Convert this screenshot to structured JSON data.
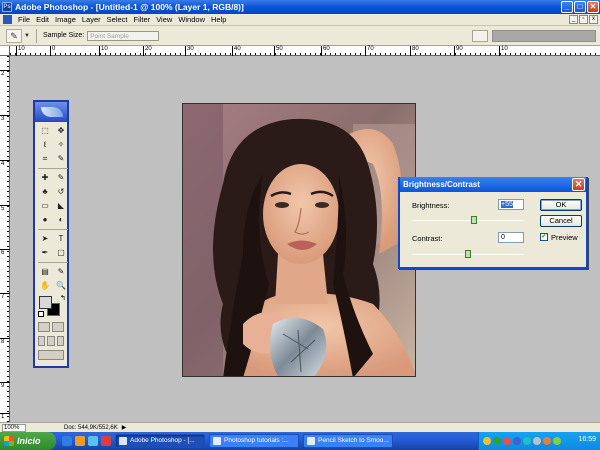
{
  "window": {
    "title": "Adobe Photoshop - [Untitled-1 @ 100% (Layer 1, RGB/8)]",
    "controls": {
      "minimize": "_",
      "maximize": "□",
      "close": "✕"
    }
  },
  "menu": [
    "File",
    "Edit",
    "Image",
    "Layer",
    "Select",
    "Filter",
    "View",
    "Window",
    "Help"
  ],
  "doc_controls": {
    "minimize": "_",
    "restore": "▫",
    "close": "x"
  },
  "options": {
    "tool_icon": "eyedropper-icon",
    "sample_size_label": "Sample Size:",
    "sample_size_value": "Point Sample"
  },
  "rulers": {
    "horizontal": [
      "10",
      "0",
      "10",
      "20",
      "30",
      "40",
      "50",
      "60",
      "70",
      "80",
      "90",
      "10"
    ],
    "vertical": [
      "2",
      "3",
      "4",
      "5",
      "6",
      "7",
      "8",
      "9",
      "1"
    ]
  },
  "toolbox": {
    "tools": [
      "marquee-icon",
      "move-icon",
      "lasso-icon",
      "magic-wand-icon",
      "crop-icon",
      "slice-icon",
      "healing-brush-icon",
      "brush-icon",
      "clone-stamp-icon",
      "history-brush-icon",
      "eraser-icon",
      "paint-bucket-icon",
      "blur-icon",
      "dodge-icon",
      "path-selection-icon",
      "type-icon",
      "pen-icon",
      "shape-icon",
      "notes-icon",
      "eyedropper-icon",
      "hand-icon",
      "zoom-icon"
    ],
    "glyphs": [
      "⬚",
      "✥",
      "ℓ",
      "✧",
      "⌗",
      "✎",
      "✚",
      "✎",
      "♣",
      "↺",
      "▭",
      "◣",
      "●",
      "◐",
      "➤",
      "T",
      "✒",
      "▢",
      "▤",
      "✎",
      "✋",
      "🔍"
    ]
  },
  "dialog": {
    "title": "Brightness/Contrast",
    "brightness_label": "Brightness:",
    "brightness_value": "+55",
    "contrast_label": "Contrast:",
    "contrast_value": "0",
    "ok_label": "OK",
    "cancel_label": "Cancel",
    "preview_label": "Preview",
    "preview_checked": true,
    "brightness_level": 0.55,
    "contrast_level": 0.5
  },
  "status": {
    "zoom": "100%",
    "doc_info": "Doc: 544,9K/552,6K"
  },
  "taskbar": {
    "start_label": "Inicio",
    "tasks": [
      "Adobe Photoshop - [...",
      "Photoshop tutorials :...",
      "Pencil Sketch to Smoo..."
    ],
    "clock": "16:59"
  }
}
